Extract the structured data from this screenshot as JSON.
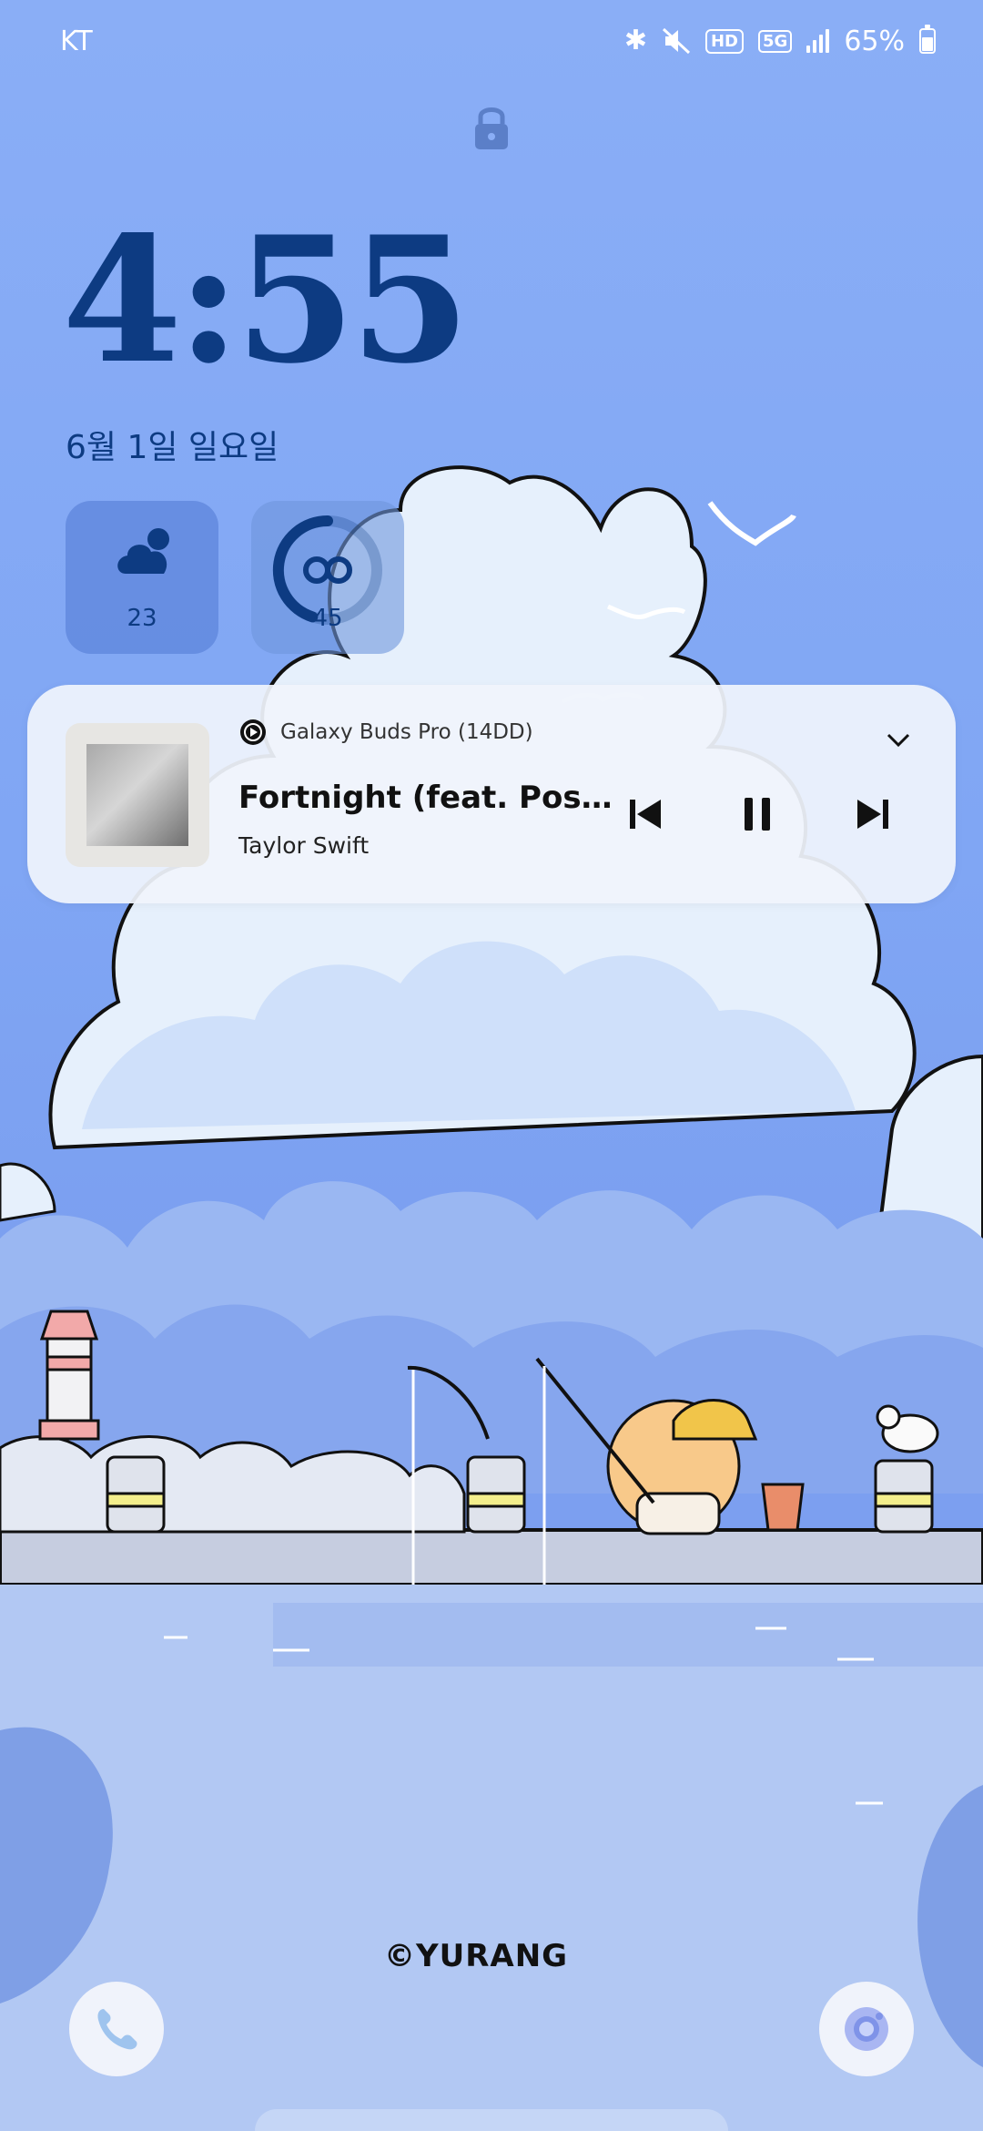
{
  "status_bar": {
    "carrier": "KT",
    "network": "5G",
    "hd": "HD",
    "battery": "65%",
    "icons": [
      "bluetooth-icon",
      "mute-icon",
      "hd-voice-icon",
      "5g-icon",
      "signal-icon",
      "battery-icon"
    ]
  },
  "clock": {
    "time": "4:55",
    "date": "6월 1일 일요일"
  },
  "widgets": {
    "weather": {
      "value": "23",
      "icon": "cloud-icon"
    },
    "buds": {
      "value": "45",
      "icon": "earbuds-icon",
      "battery_fraction": 0.45
    }
  },
  "media": {
    "output_device": "Galaxy Buds Pro (14DD)",
    "title": "Fortnight (feat. Pos…",
    "artist": "Taylor Swift",
    "state": "playing"
  },
  "watermark": "©YURANG",
  "colors": {
    "clock": "#0d3b82",
    "card": "#f0f4fc",
    "sky": "#8aaef6"
  }
}
